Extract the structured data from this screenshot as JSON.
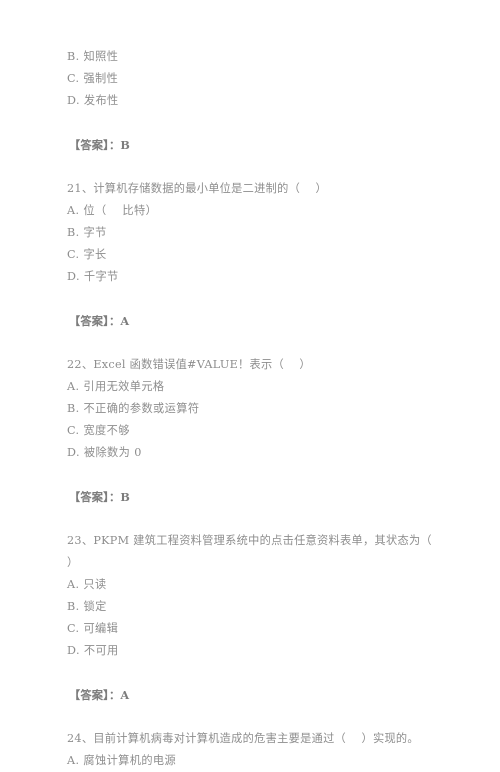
{
  "document": {
    "type": "exam-question-sheet",
    "text_color": "#8d8d8d",
    "background_color": "#ffffff",
    "answer_label_prefix": "【答案】：",
    "blocks": [
      {
        "kind": "orphan-options",
        "options": [
          "B. 知照性",
          "C. 强制性",
          "D. 发布性"
        ],
        "answer": "【答案】：B"
      },
      {
        "kind": "question",
        "number": "21",
        "stem_lines": [
          "21、计算机存储数据的最小单位是二进制的（    ）"
        ],
        "options": [
          "A. 位（    比特）",
          "B. 字节",
          "C. 字长",
          "D. 千字节"
        ],
        "answer": "【答案】：A"
      },
      {
        "kind": "question",
        "number": "22",
        "stem_lines": [
          "22、Excel 函数错误值#VALUE！表示（    ）"
        ],
        "options": [
          "A. 引用无效单元格",
          "B. 不正确的参数或运算符",
          "C. 宽度不够",
          "D. 被除数为 0"
        ],
        "answer": "【答案】：B"
      },
      {
        "kind": "question",
        "number": "23",
        "stem_lines": [
          "23、PKPM 建筑工程资料管理系统中的点击任意资料表单，其状态为（",
          "）"
        ],
        "options": [
          "A. 只读",
          "B. 锁定",
          "C. 可编辑",
          "D. 不可用"
        ],
        "answer": "【答案】：A"
      },
      {
        "kind": "question",
        "number": "24",
        "stem_lines": [
          "24、目前计算机病毒对计算机造成的危害主要是通过（    ）实现的。"
        ],
        "options": [
          "A. 腐蚀计算机的电源"
        ],
        "answer": ""
      }
    ]
  }
}
